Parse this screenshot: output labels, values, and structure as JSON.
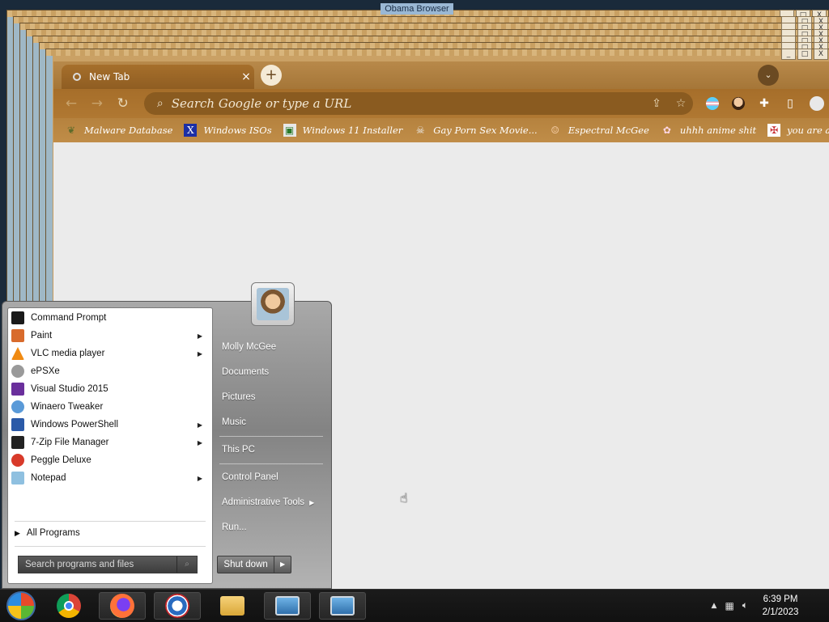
{
  "window_title": "Obama Browser",
  "ghost_window_buttons": [
    "_",
    "□",
    "X"
  ],
  "browser": {
    "tab_title": "New Tab",
    "tab_close": "×",
    "new_tab": "+",
    "tab_search": "⌄",
    "omnibox_placeholder": "Search Google or type a URL",
    "nav": {
      "back": "←",
      "forward": "→",
      "reload": "↻"
    },
    "bookmarks": [
      {
        "label": "Malware Database",
        "icon": "leaf-icon"
      },
      {
        "label": "Windows ISOs",
        "icon": "x-icon"
      },
      {
        "label": "Windows 11 Installer",
        "icon": "installer-icon"
      },
      {
        "label": "Gay Porn Sex Movie...",
        "icon": "skull-icon"
      },
      {
        "label": "Espectral McGee",
        "icon": "face-icon"
      },
      {
        "label": "uhhh anime shit",
        "icon": "anime-icon"
      },
      {
        "label": "you are an idiot!",
        "icon": "flag-icon"
      }
    ]
  },
  "start_menu": {
    "programs": [
      {
        "label": "Command Prompt",
        "icon": "cmd-icon",
        "submenu": false,
        "color": "#1a1a1a"
      },
      {
        "label": "Paint",
        "icon": "paint-icon",
        "submenu": true,
        "color": "#d86b2c"
      },
      {
        "label": "VLC media player",
        "icon": "vlc-icon",
        "submenu": true,
        "color": "#f08a12"
      },
      {
        "label": "ePSXe",
        "icon": "gamepad-icon",
        "submenu": false,
        "color": "#9a9a9a"
      },
      {
        "label": "Visual Studio 2015",
        "icon": "visual-studio-icon",
        "submenu": false,
        "color": "#6a2f9c"
      },
      {
        "label": "Winaero Tweaker",
        "icon": "tweaker-icon",
        "submenu": false,
        "color": "#5a9ad8"
      },
      {
        "label": "Windows PowerShell",
        "icon": "powershell-icon",
        "submenu": true,
        "color": "#2b5aa8"
      },
      {
        "label": "7-Zip File Manager",
        "icon": "7zip-icon",
        "submenu": true,
        "color": "#222222"
      },
      {
        "label": "Peggle Deluxe",
        "icon": "peggle-icon",
        "submenu": false,
        "color": "#d83a2a"
      },
      {
        "label": "Notepad",
        "icon": "notepad-icon",
        "submenu": true,
        "color": "#8fc0e0"
      }
    ],
    "all_programs": "All Programs",
    "search_placeholder": "Search programs and files",
    "right_items": [
      {
        "label": "Molly McGee",
        "submenu": false
      },
      {
        "label": "Documents",
        "submenu": false
      },
      {
        "label": "Pictures",
        "submenu": false
      },
      {
        "label": "Music",
        "submenu": false
      },
      {
        "label": "This PC",
        "submenu": false
      },
      {
        "label": "Control Panel",
        "submenu": false
      },
      {
        "label": "Administrative Tools",
        "submenu": true
      },
      {
        "label": "Run...",
        "submenu": false
      }
    ],
    "shutdown_label": "Shut down"
  },
  "taskbar": {
    "items": [
      "chrome-icon",
      "firefox-icon",
      "obama-browser-icon",
      "file-explorer-icon",
      "remote-pc-icon",
      "remote-pc-icon"
    ],
    "time": "6:39 PM",
    "date": "2/1/2023"
  }
}
